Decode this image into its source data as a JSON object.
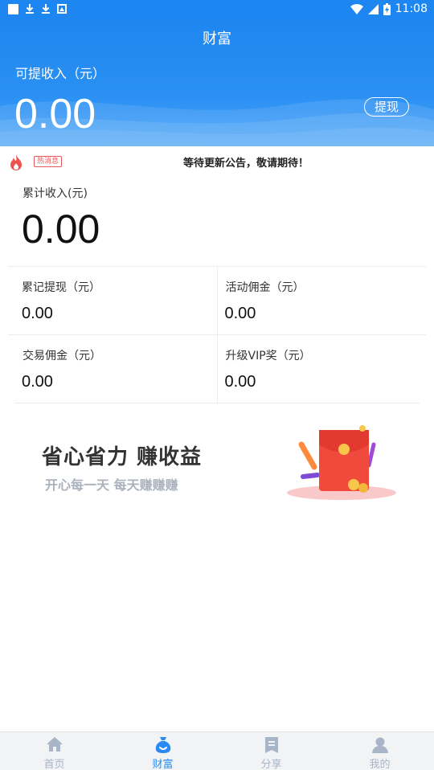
{
  "status_bar": {
    "time": "11:08"
  },
  "header": {
    "title": "财富",
    "available_label": "可提收入（元）",
    "available_value": "0.00",
    "withdraw_label": "提现"
  },
  "notice": {
    "tag": "热消息",
    "text": "等待更新公告，敬请期待！"
  },
  "total": {
    "label": "累计收入(元)",
    "value": "0.00"
  },
  "stats": [
    {
      "label": "累记提现（元）",
      "value": "0.00"
    },
    {
      "label": "活动佣金（元）",
      "value": "0.00"
    },
    {
      "label": "交易佣金（元）",
      "value": "0.00"
    },
    {
      "label": "升级VIP奖（元）",
      "value": "0.00"
    }
  ],
  "banner": {
    "title": "省心省力 赚收益",
    "subtitle": "开心每一天 每天赚赚赚"
  },
  "tabbar": {
    "active_index": 1,
    "tabs": [
      {
        "label": "首页",
        "icon": "home-icon"
      },
      {
        "label": "财富",
        "icon": "money-bag-icon"
      },
      {
        "label": "分享",
        "icon": "share-doc-icon"
      },
      {
        "label": "我的",
        "icon": "user-icon"
      }
    ]
  },
  "colors": {
    "primary": "#1e86f0",
    "tab_active": "#2a8cf2",
    "tab_inactive": "#a8b4c8",
    "hot": "#e85a5a"
  }
}
